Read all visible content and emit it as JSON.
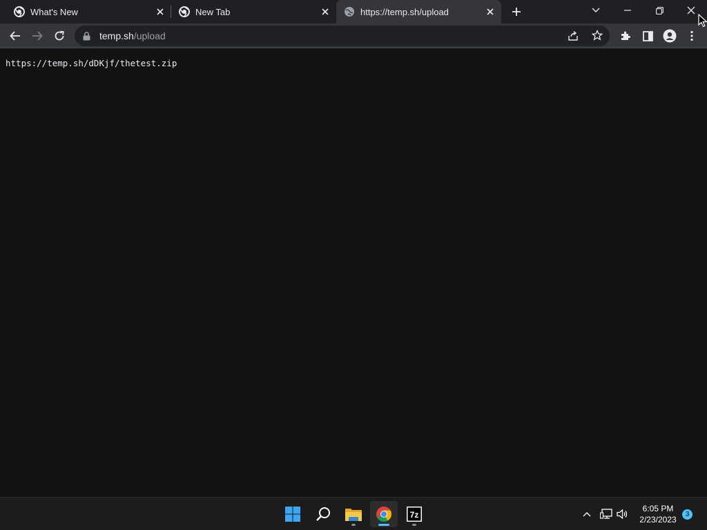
{
  "tabs": [
    {
      "title": "What's New",
      "favicon": "chrome-icon",
      "active": false
    },
    {
      "title": "New Tab",
      "favicon": "chrome-icon",
      "active": false
    },
    {
      "title": "https://temp.sh/upload",
      "favicon": "globe-icon",
      "active": true
    }
  ],
  "address_bar": {
    "host": "temp.sh",
    "path": "/upload"
  },
  "page": {
    "text": "https://temp.sh/dDKjf/thetest.zip"
  },
  "taskbar": {
    "apps": [
      "windows-start-icon",
      "search-icon",
      "file-explorer-icon",
      "chrome-icon",
      "7zip-icon"
    ],
    "time": "6:05 PM",
    "date": "2/23/2023",
    "notification_count": "3",
    "sevenzip_label": "7z"
  },
  "colors": {
    "tabstrip_bg": "#1f2023",
    "toolbar_bg": "#35363a",
    "omnibox_bg": "#202124",
    "page_bg": "#121212",
    "taskbar_bg": "#1c1c1c",
    "accent": "#4cc2ff"
  }
}
